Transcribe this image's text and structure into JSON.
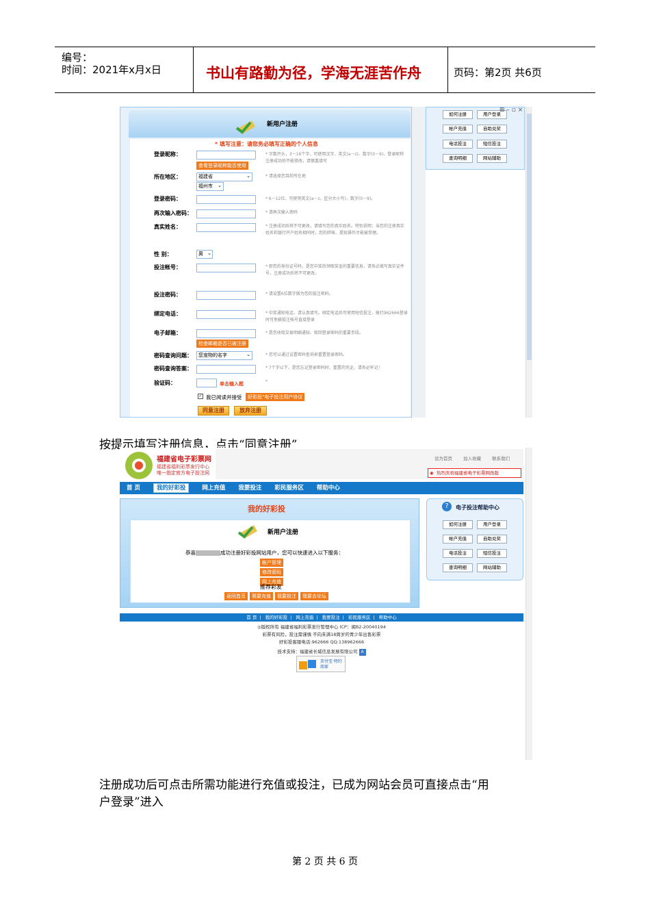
{
  "header": {
    "number_label": "编号：",
    "date_label": "时间：2021年x月x日",
    "motto": "书山有路勤为径，学海无涯苦作舟",
    "page_label": "页码：第2页  共6页"
  },
  "reg_form": {
    "title": "新用户注册",
    "notice": "* 填写注意：请您务必填写正确的个人信息",
    "fields": [
      {
        "label": "登录昵称：",
        "hint": "* 字数开头，3－16个字，可使用汉字、英文(a－z)、数字(0－9)，登录昵称注册成功后不能修改，请慎重填写"
      },
      {
        "label": "所在地区：",
        "hint": "* 请选择您目前所在地"
      },
      {
        "label": "登录密码：",
        "hint": "* 6－12位，可使用英文(a－z，区分大小写)，数字(0－9)。"
      },
      {
        "label": "再次输入密码：",
        "hint": "* 请再次输入密码"
      },
      {
        "label": "真实姓名：",
        "hint": "* 注册成功后将不可更改，请填写您的真实姓名。特别说明：当您的注册真实姓名和银行开户姓名相同时，您的转帐、提现操作才能被受理。"
      },
      {
        "label": "性 别：",
        "hint": ""
      },
      {
        "label": "投注帐号：",
        "hint": "* 即您的身份证号码，是您中奖后领取奖金的重要信息，请务必填写真实证件号，注册成功后将不可更改。"
      },
      {
        "label": "投注密码：",
        "hint": "* 请设置6位数字做为您的投注密码。"
      },
      {
        "label": "绑定电话：",
        "hint": "* 中奖通知电话，请认真填写。绑定电话后可使用短信投注，拨打962666登录时可免输投注帐号直接登录"
      },
      {
        "label": "电子邮箱：",
        "hint": "* 是您收取交易明细通知、取回登录密码的重要手段。"
      },
      {
        "label": "密码查询问题：",
        "hint": "* 您可以通过设置密码查询来重置登录密码。"
      },
      {
        "label": "密码查询答案：",
        "hint": "* 7个字以下，是您忘记登录密码时，重置的凭证，请务必牢记！"
      },
      {
        "label": "验证码：",
        "hint": "*"
      }
    ],
    "check_nick": "查看登录昵称能否使用",
    "province": "福建省",
    "city": "福州市",
    "gender": "男",
    "check_email": "检查邮箱是否已被注册",
    "question": "您宠物的名字",
    "captcha_link": "单击输入框",
    "agree_text": "我已阅读并接受",
    "agreement": "好彩投\"电子投注用户协议",
    "agree_btn": "同意注册",
    "cancel_btn": "放弃注册"
  },
  "side_buttons": [
    "如何注册",
    "用户登录",
    "帐户充值",
    "自助兑奖",
    "电话投注",
    "短信投注",
    "查询明细",
    "网站辅助"
  ],
  "caption1": "按提示填写注册信息，点击“同意注册”",
  "site": {
    "name": "福建省电子彩票网",
    "sub1": "福建省福利彩票发行中心",
    "sub2": "唯一指定官方电子投注网",
    "top_links": [
      "设为首页",
      "加入收藏",
      "联系我们"
    ],
    "ticker": "热烈庆祝福建省电子彩票网改版",
    "nav": [
      "首 页",
      "我的好彩投",
      "网上充值",
      "我要投注",
      "彩民服务区",
      "帮助中心"
    ],
    "my_title": "我的好彩投",
    "reg_title": "新用户注册",
    "success_pre": "恭喜",
    "success_post": "成功注册好彩投网站用户，您可以快速进入以下服务：",
    "services": [
      "帐户管理",
      "修改密码",
      "网上充值"
    ],
    "recommend": "推荐彩友",
    "bottom_btns": [
      "返回首页",
      "我要充值",
      "我要投注",
      "我要去论坛"
    ],
    "help_title": "电子投注帮助中心",
    "footer_nav": [
      "首 页",
      "我的好彩投",
      "网上充值",
      "我要投注",
      "彩民服务区",
      "帮助中心"
    ],
    "footer_lines": [
      "◎版权所有 福建省福利彩票发行管理中心 ICP：闽B2-20040194",
      "彩票有风险，投注需谨慎 不向未满18周岁的青少年出售彩票",
      "好彩投客服电话:962666 QQ:138962666",
      "技术支持：福建省长城信息发展有限公司"
    ],
    "alipay": "支付宝·特约商家"
  },
  "caption2_l1": "注册成功后可点击所需功能进行充值或投注，已成为网站会员可直接点击“用",
  "caption2_l2": "户登录”进入",
  "footer": "第 2 页 共 6 页"
}
